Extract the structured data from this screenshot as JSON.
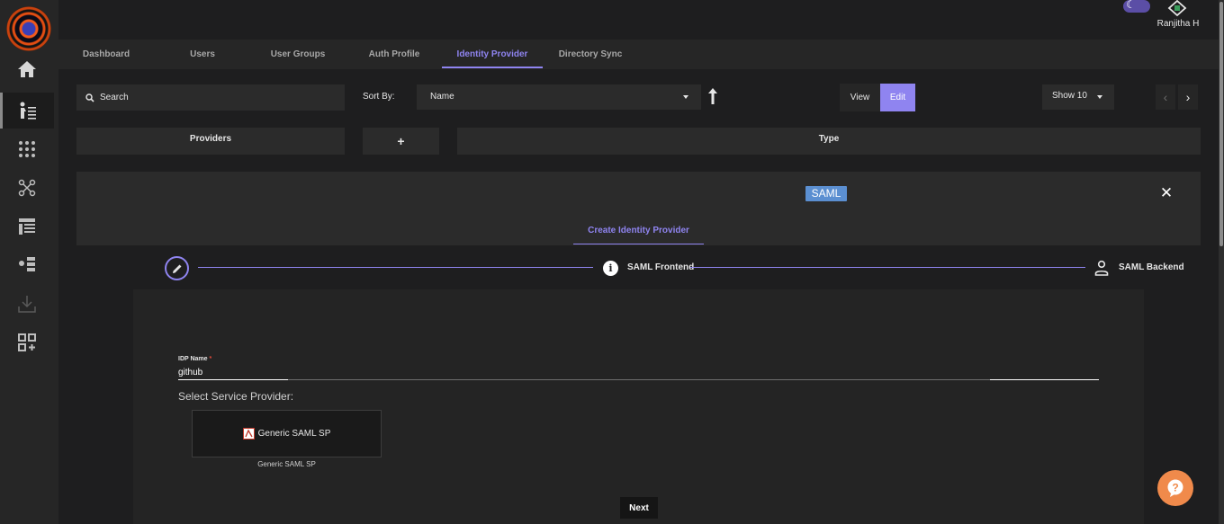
{
  "app": {
    "user_name": "Ranjitha H"
  },
  "sidebar": {
    "items": [
      {
        "icon": "home-icon"
      },
      {
        "icon": "users-list-icon",
        "active": true
      },
      {
        "icon": "user-groups-grid-icon"
      },
      {
        "icon": "auth-profile-icon"
      },
      {
        "icon": "identity-provider-icon"
      },
      {
        "icon": "directory-sync-icon"
      },
      {
        "icon": "download-icon"
      },
      {
        "icon": "apps-add-icon"
      }
    ]
  },
  "tabs": [
    {
      "label": "Dashboard"
    },
    {
      "label": "Users"
    },
    {
      "label": "User Groups"
    },
    {
      "label": "Auth Profile"
    },
    {
      "label": "Identity Provider",
      "active": true
    },
    {
      "label": "Directory Sync"
    }
  ],
  "toolbar": {
    "search_placeholder": "Search",
    "sort_by_label": "Sort By:",
    "sort_value": "Name",
    "view_label": "View",
    "edit_label": "Edit",
    "show_value": "Show 10",
    "prev": "‹",
    "next": "›"
  },
  "columns": {
    "providers": "Providers",
    "add": "+",
    "type": "Type"
  },
  "panel": {
    "badge": "SAML",
    "close": "✕",
    "tab_title": "Create Identity Provider"
  },
  "stepper": {
    "steps": [
      {
        "label": ""
      },
      {
        "label": "SAML Frontend",
        "icon_text": "i"
      },
      {
        "label": "SAML Backend"
      }
    ]
  },
  "form": {
    "idp_name_label": "IDP Name",
    "required_mark": "*",
    "idp_name_value": "github",
    "select_sp_label": "Select Service Provider:",
    "sp_option": "Generic SAML SP",
    "sp_caption": "Generic SAML SP",
    "next_button": "Next"
  },
  "colors": {
    "accent": "#8f84f0",
    "saml_badge": "#5b8fd1",
    "help": "#f08a4b",
    "background": "#1e1e1f"
  }
}
